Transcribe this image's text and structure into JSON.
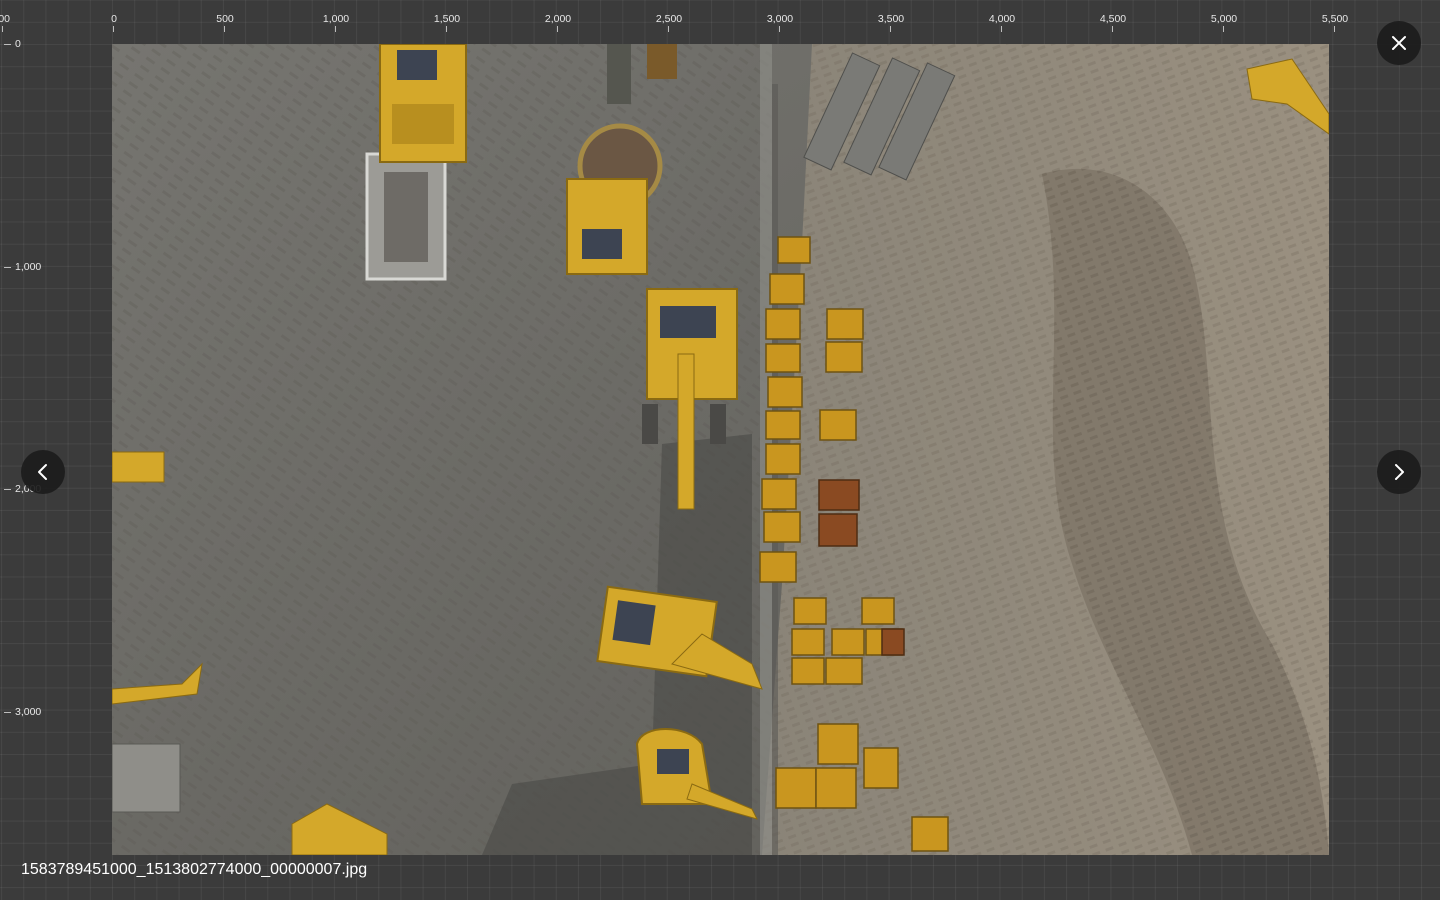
{
  "viewer": {
    "filename": "1583789451000_1513802774000_00000007.jpg",
    "photo_description_icon": "aerial-construction-photo"
  },
  "ruler_top": {
    "ticks": [
      "00",
      "0",
      "500",
      "1,000",
      "1,500",
      "2,000",
      "2,500",
      "3,000",
      "3,500",
      "4,000",
      "4,500",
      "5,000",
      "5,500"
    ]
  },
  "ruler_left": {
    "ticks": [
      "0",
      "1,000",
      "2,000",
      "3,000"
    ]
  },
  "controls": {
    "close_icon": "close-icon",
    "prev_icon": "chevron-left-icon",
    "next_icon": "chevron-right-icon"
  },
  "colors": {
    "background": "#3b3b3b",
    "button": "#1c1c1c",
    "machinery_yellow": "#d4a82a",
    "ground_gray": "#6f6e6a",
    "dirt_tan": "#8c8170"
  }
}
